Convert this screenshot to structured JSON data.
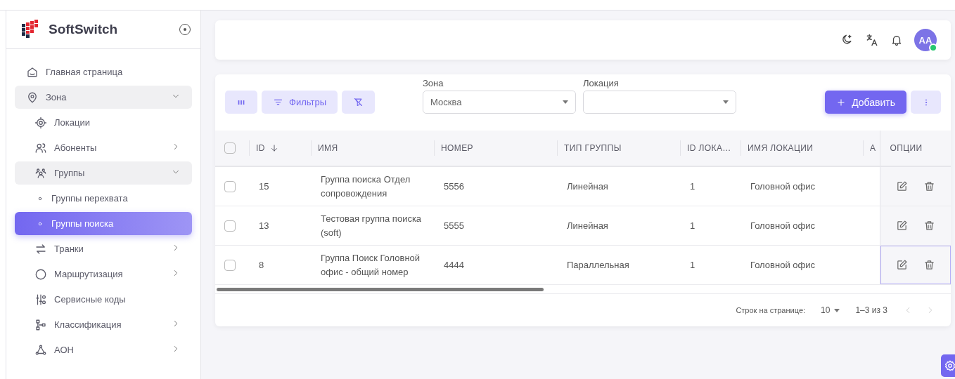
{
  "sidebar": {
    "brand": "SoftSwitch",
    "pinned": true,
    "items": [
      {
        "label": "Главная страница",
        "selected": false
      },
      {
        "label": "Зона",
        "selected": false,
        "expanded": true,
        "children": [
          {
            "label": "Локации",
            "selected": false
          },
          {
            "label": "Абоненты",
            "selected": false,
            "expanded": false
          },
          {
            "label": "Группы",
            "selected": false,
            "expanded": true,
            "children": [
              {
                "label": "Группы перехвата",
                "selected": false
              },
              {
                "label": "Группы поиска",
                "selected": true
              }
            ]
          },
          {
            "label": "Транки",
            "selected": false,
            "expanded": false
          },
          {
            "label": "Маршрутизация",
            "selected": false,
            "expanded": false
          },
          {
            "label": "Сервисные коды",
            "selected": false
          },
          {
            "label": "Классификация",
            "selected": false,
            "expanded": false
          },
          {
            "label": "АОН",
            "selected": false,
            "expanded": false
          }
        ]
      }
    ]
  },
  "topbar": {
    "avatar": {
      "initials": "AA",
      "online": true
    }
  },
  "toolbar": {
    "filters_button": "Фильтры",
    "add_button": "Добавить",
    "zone": {
      "label": "Зона",
      "value": "Москва"
    },
    "location": {
      "label": "Локация"
    }
  },
  "table": {
    "columns": [
      {
        "label": "ID",
        "sorted": true
      },
      {
        "label": "ИМЯ"
      },
      {
        "label": "НОМЕР"
      },
      {
        "label": "ТИП ГРУППЫ"
      },
      {
        "label": "ID ЛОКА…"
      },
      {
        "label": "ИМЯ ЛОКАЦИИ"
      },
      {
        "label": "А"
      }
    ],
    "options_column": "ОПЦИИ",
    "all_checked": false,
    "rows": [
      {
        "checked": false,
        "focused": false,
        "cells": [
          "15",
          "Группа поиска Отдел сопровождения",
          "5556",
          "Линейная",
          "1",
          "Головной офис"
        ]
      },
      {
        "checked": false,
        "focused": false,
        "cells": [
          "13",
          "Тестовая группа поиска (soft)",
          "5555",
          "Линейная",
          "1",
          "Головной офис"
        ]
      },
      {
        "checked": false,
        "focused": true,
        "cells": [
          "8",
          "Группа Поиск Головной офис - общий номер",
          "4444",
          "Параллельная",
          "1",
          "Головной офис"
        ]
      }
    ]
  },
  "pagination": {
    "rows_label": "Строк на странице:",
    "rows_per_page": "10",
    "range": "1–3 из 3",
    "prev_disabled": true,
    "next_disabled": true
  }
}
